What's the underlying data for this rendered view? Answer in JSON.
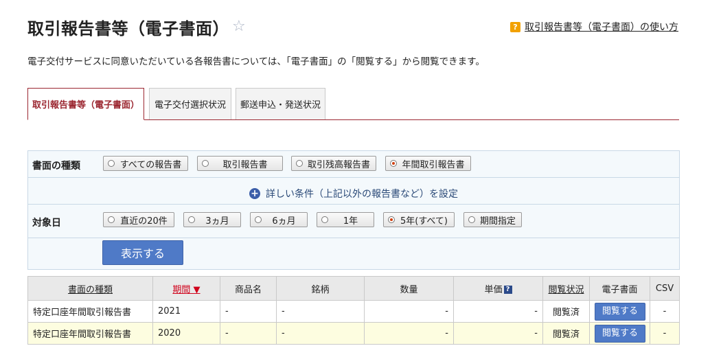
{
  "page": {
    "title": "取引報告書等（電子書面）",
    "help_link": "取引報告書等（電子書面）の使い方",
    "description": "電子交付サービスに同意いただいている各報告書については、「電子書面」の「閲覧する」から閲覧できます。"
  },
  "tabs": [
    {
      "label": "取引報告書等（電子書面）",
      "active": true
    },
    {
      "label": "電子交付選択状況",
      "active": false
    },
    {
      "label": "郵送申込・発送状況",
      "active": false
    }
  ],
  "filter": {
    "doc_type_label": "書面の種類",
    "doc_type_options": [
      "すべての報告書",
      "取引報告書",
      "取引残高報告書",
      "年間取引報告書"
    ],
    "doc_type_selected": "年間取引報告書",
    "detail_link": "詳しい条件（上記以外の報告書など）を設定",
    "date_label": "対象日",
    "date_options": [
      "直近の20件",
      "3ヵ月",
      "6ヵ月",
      "1年",
      "5年(すべて)",
      "期間指定"
    ],
    "date_selected": "5年(すべて)",
    "show_button": "表示する"
  },
  "table": {
    "headers": {
      "doc_type": "書面の種類",
      "period": "期間 ▼",
      "product": "商品名",
      "issue": "銘柄",
      "quantity": "数量",
      "unit_price": "単価",
      "view_status": "閲覧状況",
      "e_doc": "電子書面",
      "csv": "CSV"
    },
    "rows": [
      {
        "doc_type": "特定口座年間取引報告書",
        "period": "2021",
        "product": "-",
        "issue": "-",
        "quantity": "-",
        "unit_price": "-",
        "view_status": "閲覧済",
        "e_doc": "閲覧する",
        "csv": "-"
      },
      {
        "doc_type": "特定口座年間取引報告書",
        "period": "2020",
        "product": "-",
        "issue": "-",
        "quantity": "-",
        "unit_price": "-",
        "view_status": "閲覧済",
        "e_doc": "閲覧する",
        "csv": "-"
      }
    ]
  },
  "colors": {
    "accent": "#9b2630",
    "button": "#4f7ac7",
    "panel": "#f4f9fc",
    "alt_row": "#fdfde0"
  }
}
